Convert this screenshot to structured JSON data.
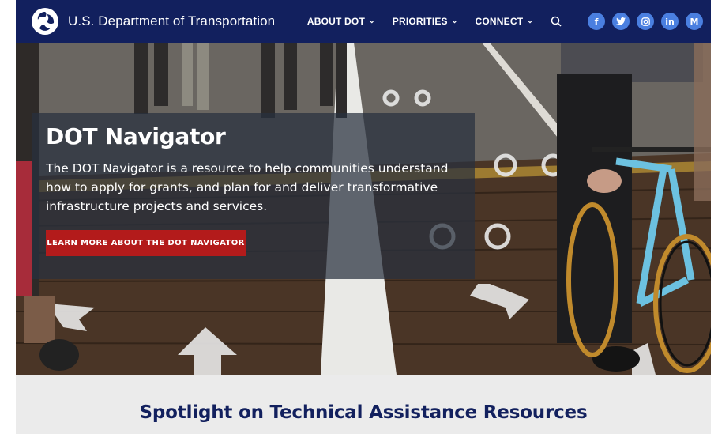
{
  "header": {
    "site_title": "U.S. Department of Transportation",
    "nav": [
      {
        "label": "ABOUT DOT"
      },
      {
        "label": "PRIORITIES"
      },
      {
        "label": "CONNECT"
      }
    ],
    "social": [
      {
        "icon": "facebook-icon",
        "glyph": "f"
      },
      {
        "icon": "twitter-icon",
        "glyph": "t"
      },
      {
        "icon": "instagram-icon",
        "glyph": "◎"
      },
      {
        "icon": "linkedin-icon",
        "glyph": "in"
      },
      {
        "icon": "medium-icon",
        "glyph": "M"
      }
    ]
  },
  "hero": {
    "title": "DOT Navigator",
    "description": "The DOT Navigator is a resource to help communities understand how to apply for grants, and plan for and deliver transformative infrastructure projects and services.",
    "button_label": "LEARN MORE ABOUT THE DOT NAVIGATOR"
  },
  "spotlight": {
    "title": "Spotlight on Technical Assistance Resources"
  },
  "colors": {
    "header_bg": "#12205e",
    "social_bg": "#4a7fe0",
    "button_bg": "#b31b1b",
    "spotlight_bg": "#ebebeb",
    "spotlight_title": "#12205e"
  }
}
